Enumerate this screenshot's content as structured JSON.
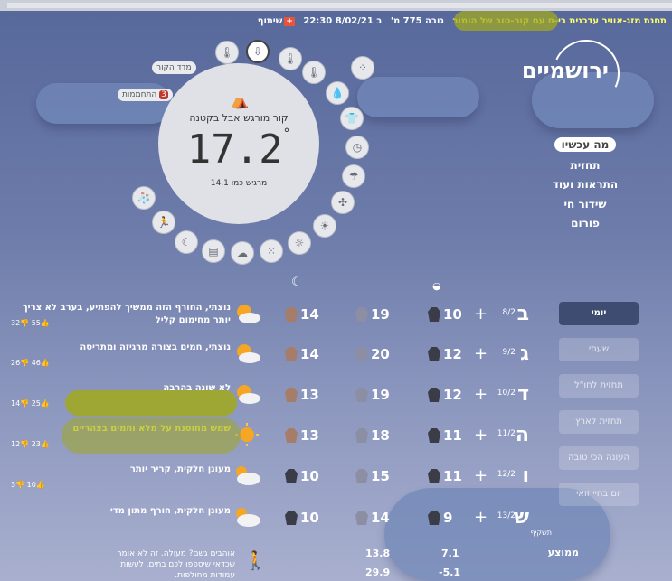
{
  "header": {
    "station": "תחנת מזג-אוויר עדכנית בי-ם עם קור-טוב של הומור",
    "altitude": "גובה 775 מ'",
    "datetime": "ב 8/02/21 22:30",
    "share": "שיתוף"
  },
  "logo": {
    "text": "ירושמיים"
  },
  "nav": [
    {
      "label": "מה עכשיו",
      "active": true
    },
    {
      "label": "תחזית"
    },
    {
      "label": "התראות ועוד"
    },
    {
      "label": "שידור חי"
    },
    {
      "label": "פורום"
    }
  ],
  "current": {
    "condition": "קור מורגש אבל בקטנה",
    "temperature": "17.2",
    "degree": "°",
    "feels_like": "מרגיש כמו 14.1"
  },
  "dial_pills": {
    "cold_meter": "מדד הקור",
    "alerts": "התחממות",
    "alerts_count": "3"
  },
  "tabs": [
    {
      "label": "יומי",
      "active": true
    },
    {
      "label": "שעתי"
    },
    {
      "label": "תחזית לחו\"ל"
    },
    {
      "label": "תחזית לארץ"
    },
    {
      "label": "העונה הכי טובה"
    },
    {
      "label": "יום בחיי זואי"
    }
  ],
  "forecast": [
    {
      "day": "ב",
      "date": "8/2",
      "day_min": "10",
      "day_max": "19",
      "night": "14",
      "desc": "נוצתי, החורף הזה ממשיך להפתיע, בערב לא צריך יותר מחימום קליל",
      "likes": "55",
      "dislikes": "32",
      "icon": "sun-cloud",
      "highlight": false
    },
    {
      "day": "ג",
      "date": "9/2",
      "day_min": "12",
      "day_max": "20",
      "night": "14",
      "desc": "נוצתי, חמים בצורה מרגיזה ומתריסה",
      "likes": "46",
      "dislikes": "26",
      "icon": "sun-cloud",
      "highlight": false
    },
    {
      "day": "ד",
      "date": "10/2",
      "day_min": "12",
      "day_max": "19",
      "night": "13",
      "desc": "לא שונה בהרבה",
      "likes": "25",
      "dislikes": "14",
      "icon": "sun-cloud",
      "highlight": false
    },
    {
      "day": "ה",
      "date": "11/2",
      "day_min": "11",
      "day_max": "18",
      "night": "13",
      "desc": "שמש מחוסנת על מלא וחמים בצהריים",
      "likes": "23",
      "dislikes": "12",
      "icon": "sun",
      "highlight": true
    },
    {
      "day": "ו",
      "date": "12/2",
      "day_min": "11",
      "day_max": "15",
      "night": "10",
      "desc": "מעונן חלקית, קריר יותר",
      "likes": "10",
      "dislikes": "3",
      "icon": "cloud-sun",
      "highlight": false
    },
    {
      "day": "ש",
      "date": "13/2",
      "day_min": "9",
      "day_max": "14",
      "night": "10",
      "desc": "מעונן חלקית, חורף מתון מדי",
      "likes": "",
      "dislikes": "",
      "icon": "cloud-sun",
      "highlight": false
    }
  ],
  "summary": {
    "avg_label": "ממוצע",
    "avg_low": "7.1",
    "avg_high": "13.8",
    "rec_low": "-5.1",
    "rec_high": "29.9",
    "promo": "אוהבים גשם? מעולה. זה לא אומר שכדאי שיספפו לכם בתים, לעשות עמודות מחולפות.",
    "forecast_sub": "תשקיף"
  },
  "colors": {
    "highlight": "#ffff66",
    "scribble": "#a0a823",
    "accent_red": "#c0392b"
  }
}
